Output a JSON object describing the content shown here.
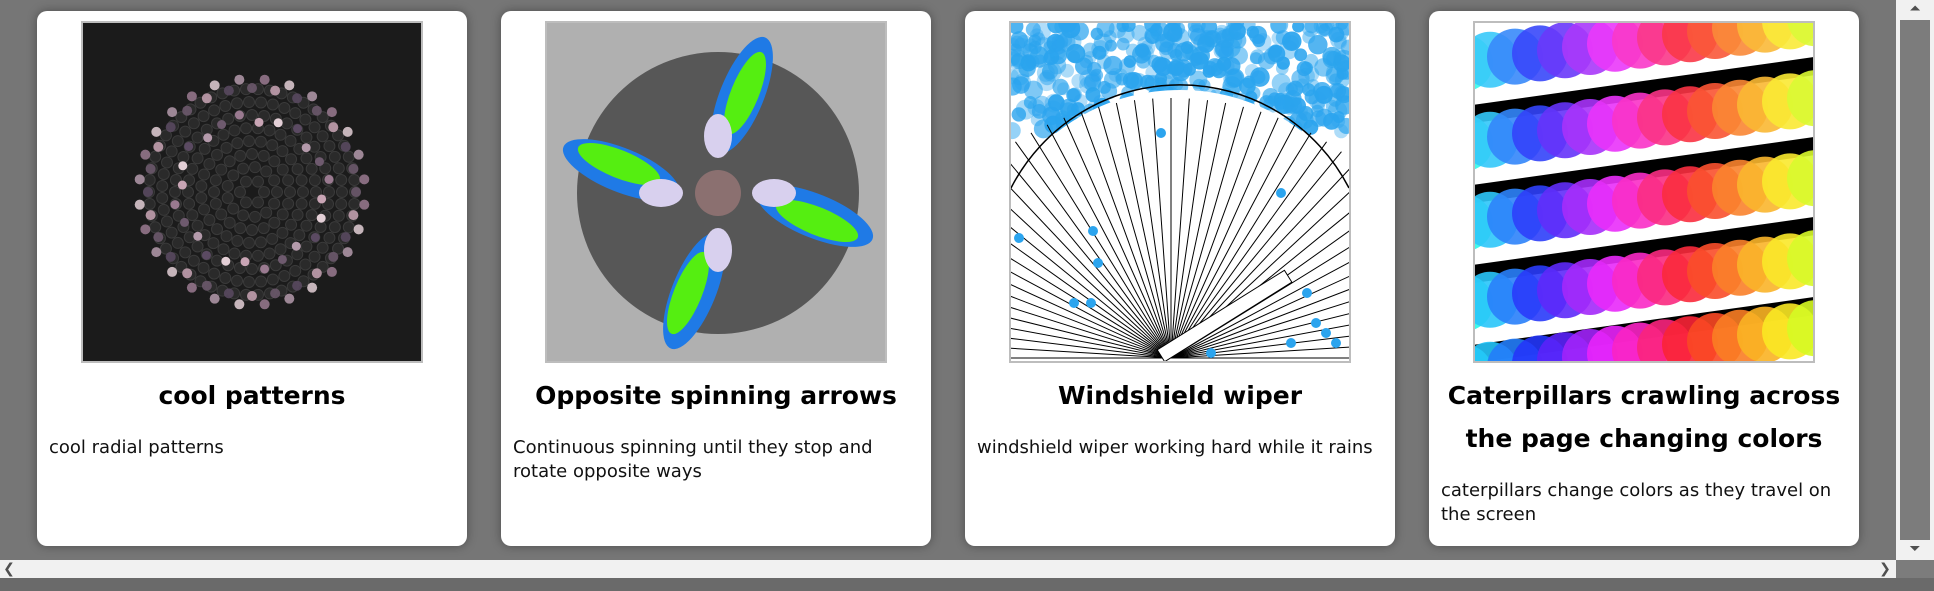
{
  "cards": [
    {
      "title": "cool patterns",
      "description": "cool radial patterns",
      "thumbnail_icon": "radial-pattern-thumbnail"
    },
    {
      "title": "Opposite spinning arrows",
      "description": "Continuous spinning until they stop and rotate opposite ways",
      "thumbnail_icon": "spinning-arrows-thumbnail"
    },
    {
      "title": "Windshield wiper",
      "description": "windshield wiper working hard while it rains",
      "thumbnail_icon": "windshield-wiper-thumbnail"
    },
    {
      "title": "Caterpillars crawling across the page changing colors",
      "description": "caterpillars change colors as they travel on the screen",
      "thumbnail_icon": "caterpillars-thumbnail"
    }
  ],
  "scrollbars": {
    "up": "⏶",
    "down": "⏷",
    "left": "❮",
    "right": "❯"
  },
  "colors": {
    "page_bg": "#767676",
    "card_bg": "#ffffff",
    "rain_blue": "#2ba4ee",
    "arrow_blue": "#1f7ae6",
    "arrow_green": "#55ee11",
    "hub": "#8b7070"
  }
}
